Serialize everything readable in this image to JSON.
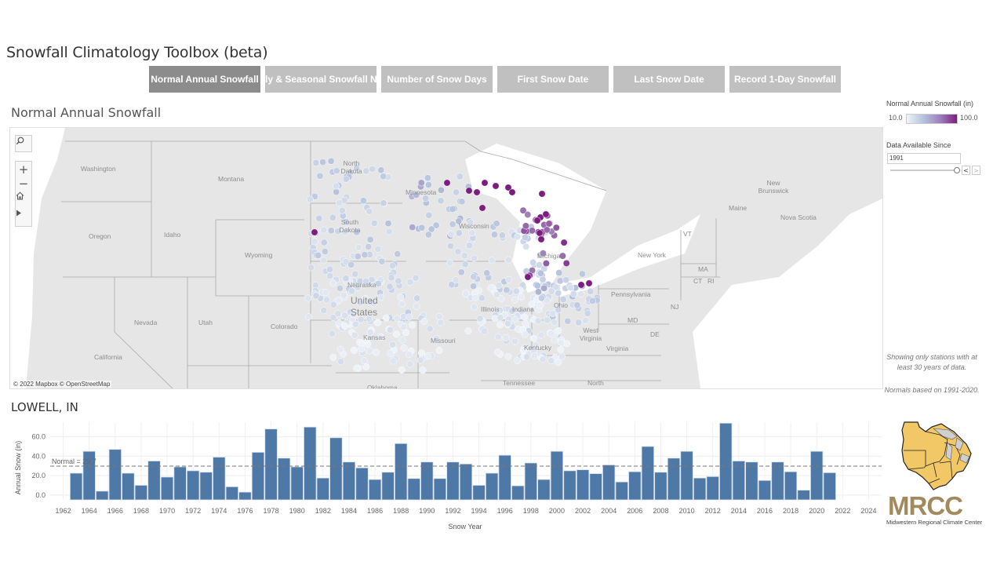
{
  "app": {
    "title": "Snowfall Climatology Toolbox (beta)"
  },
  "tabs": [
    {
      "label": "Normal Annual Snowfall",
      "active": true
    },
    {
      "label": "ly & Seasonal Snowfall No",
      "active": false
    },
    {
      "label": "Number of Snow Days",
      "active": false
    },
    {
      "label": "First Snow Date",
      "active": false
    },
    {
      "label": "Last Snow Date",
      "active": false
    },
    {
      "label": "Record 1-Day Snowfall",
      "active": false
    }
  ],
  "map": {
    "title": "Normal Annual Snowfall",
    "attribution": "© 2022 Mapbox © OpenStreetMap",
    "controls": {
      "search_icon": "search-icon",
      "zoom_in": "+",
      "zoom_out": "−",
      "home_icon": "home-icon",
      "expand_icon": "play-icon"
    },
    "labels": [
      "Washington",
      "Montana",
      "Oregon",
      "Idaho",
      "Wyoming",
      "Nevada",
      "Utah",
      "Colorado",
      "California",
      "North Dakota",
      "South Dakota",
      "Minnesota",
      "Wisconsin",
      "Michigan",
      "Nebraska",
      "United States",
      "Kansas",
      "Missouri",
      "Illinois",
      "Indiana",
      "Ohio",
      "Kentucky",
      "West Virginia",
      "Virginia",
      "Tennessee",
      "Oklahoma",
      "North",
      "Pennsylvania",
      "New York",
      "VT",
      "MA",
      "CT",
      "RI",
      "NJ",
      "MD",
      "DE",
      "Maine",
      "New Brunswick",
      "Nova Scotia"
    ],
    "colors": {
      "low": "#eef3f8",
      "mid": "#b4c2dc",
      "high": "#7d1d80"
    }
  },
  "legend": {
    "title": "Normal Annual Snowfall (in)",
    "min": "10.0",
    "max": "100.0"
  },
  "filter": {
    "title": "Data Available Since",
    "value": "1991",
    "prev": "<",
    "next": ">"
  },
  "notes": {
    "stations": "Showing only stations with at least 30 years of data.",
    "normals": "Normals based on 1991-2020."
  },
  "station": {
    "title": "LOWELL, IN"
  },
  "logo": {
    "name": "MRCC",
    "subtitle": "Midwestern Regional Climate Center"
  },
  "chart_data": {
    "type": "bar",
    "title": "LOWELL, IN",
    "xlabel": "Snow Year",
    "ylabel": "Annual Snow (in)",
    "ylim": [
      -5,
      75
    ],
    "xlim": [
      1961,
      2025
    ],
    "yticks": [
      "0.0",
      "20.0",
      "40.0",
      "60.0"
    ],
    "ytick_values": [
      0,
      20,
      40,
      60
    ],
    "xticks": [
      "1962",
      "1964",
      "1966",
      "1968",
      "1970",
      "1972",
      "1974",
      "1976",
      "1978",
      "1980",
      "1982",
      "1984",
      "1986",
      "1988",
      "1990",
      "1992",
      "1994",
      "1996",
      "1998",
      "2000",
      "2002",
      "2004",
      "2006",
      "2008",
      "2010",
      "2012",
      "2014",
      "2016",
      "2018",
      "2020",
      "2022",
      "2024"
    ],
    "grid": true,
    "bar_color": "#4e79a7",
    "reference_line": {
      "label": "Normal = 29.7",
      "value": 29.7
    },
    "categories": [
      1963,
      1964,
      1965,
      1966,
      1967,
      1968,
      1969,
      1970,
      1971,
      1972,
      1973,
      1974,
      1975,
      1976,
      1977,
      1978,
      1979,
      1980,
      1981,
      1982,
      1983,
      1984,
      1985,
      1986,
      1987,
      1988,
      1989,
      1990,
      1991,
      1992,
      1993,
      1994,
      1995,
      1996,
      1997,
      1998,
      1999,
      2000,
      2001,
      2002,
      2003,
      2004,
      2005,
      2006,
      2007,
      2008,
      2009,
      2010,
      2011,
      2012,
      2013,
      2014,
      2015,
      2016,
      2017,
      2018,
      2019,
      2020,
      2021
    ],
    "values": [
      22.5,
      45,
      4,
      47,
      22.5,
      10,
      35,
      18.5,
      29,
      25,
      23.5,
      39,
      8.5,
      3,
      44,
      68,
      38,
      29,
      70,
      17.5,
      59,
      34,
      28,
      16,
      23.5,
      53,
      17,
      34,
      17,
      34,
      32,
      10,
      22.5,
      41,
      9.5,
      33,
      16,
      45,
      25,
      26,
      22,
      31,
      13.5,
      24,
      50,
      23.5,
      38,
      45,
      17.5,
      19,
      74,
      35,
      34,
      15,
      34,
      24,
      5,
      45,
      23
    ]
  }
}
